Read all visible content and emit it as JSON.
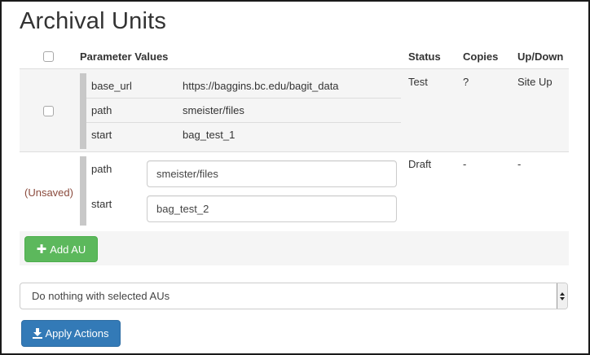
{
  "page": {
    "title": "Archival Units"
  },
  "table": {
    "headers": {
      "parameter_values": "Parameter Values",
      "status": "Status",
      "copies": "Copies",
      "up_down": "Up/Down"
    },
    "saved_row": {
      "params": [
        {
          "key": "base_url",
          "value": "https://baggins.bc.edu/bagit_data"
        },
        {
          "key": "path",
          "value": "smeister/files"
        },
        {
          "key": "start",
          "value": "bag_test_1"
        }
      ],
      "status": "Test",
      "copies": "?",
      "up_down": "Site Up",
      "checked": false
    },
    "unsaved_row": {
      "label": "(Unsaved)",
      "params": [
        {
          "key": "path",
          "value": "smeister/files"
        },
        {
          "key": "start",
          "value": "bag_test_2"
        }
      ],
      "status": "Draft",
      "copies": "-",
      "up_down": "-"
    }
  },
  "actions": {
    "add_au_label": "Add AU",
    "add_au_icon": "plus-icon",
    "select_value": "Do nothing with selected AUs",
    "apply_label": "Apply Actions",
    "apply_icon": "download-icon"
  },
  "colors": {
    "add_button": "#5cb85c",
    "apply_button": "#337ab7",
    "unsaved_text": "#8a4a3c",
    "row_bg": "#f5f5f5"
  }
}
